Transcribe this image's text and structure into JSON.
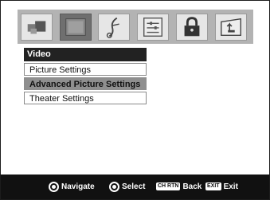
{
  "menu": {
    "title": "Video",
    "items": [
      {
        "label": "Picture Settings"
      },
      {
        "label": "Advanced Picture Settings"
      },
      {
        "label": "Theater Settings"
      }
    ]
  },
  "footer": {
    "navigate": {
      "label": "Navigate"
    },
    "select": {
      "label": "Select"
    },
    "back": {
      "key": "CH RTN",
      "label": "Back"
    },
    "exit": {
      "key": "EXIT",
      "label": "Exit"
    }
  },
  "icons": [
    "setup-icon",
    "picture-icon",
    "audio-note-icon",
    "preferences-icon",
    "lock-icon",
    "applications-icon"
  ]
}
